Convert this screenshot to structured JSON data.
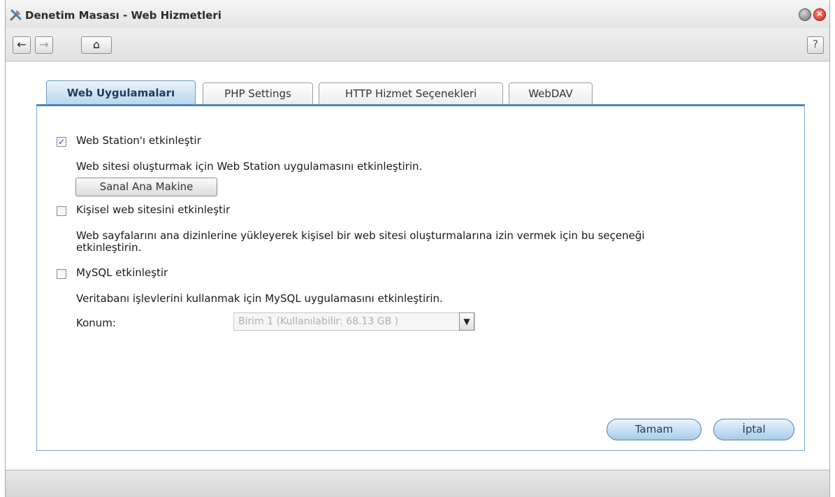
{
  "window": {
    "title": "Denetim Masası - Web Hizmetleri",
    "close_glyph": "✕",
    "icons": {
      "app": "tools-icon",
      "minimize": "minimize-icon",
      "close": "close-icon"
    }
  },
  "toolbar": {
    "back_glyph": "←",
    "forward_glyph": "→",
    "home_glyph": "⌂",
    "help_glyph": "?"
  },
  "tabs": [
    {
      "label": "Web Uygulamaları",
      "active": true
    },
    {
      "label": "PHP Settings",
      "active": false
    },
    {
      "label": "HTTP Hizmet Seçenekleri",
      "active": false
    },
    {
      "label": "WebDAV",
      "active": false
    }
  ],
  "web_station": {
    "checked": true,
    "check_glyph": "✓",
    "label": "Web Station'ı etkinleştir",
    "description": "Web sitesi oluşturmak için Web Station uygulamasını etkinleştirin.",
    "button_label": "Sanal Ana Makine"
  },
  "personal_site": {
    "checked": false,
    "label": "Kişisel web sitesini etkinleştir",
    "description_line1": "Web sayfalarını ana dizinlerine yükleyerek kişisel bir web sitesi oluşturmalarına izin vermek için bu seçeneği",
    "description_line2": "etkinleştirin."
  },
  "mysql": {
    "checked": false,
    "label": "MySQL etkinleştir",
    "description": "Veritabanı işlevlerini kullanmak için MySQL uygulamasını etkinleştirin.",
    "location_label": "Konum:",
    "location_value": "Birim 1 (Kullanılabilir: 68.13 GB )",
    "dropdown_glyph": "▼"
  },
  "actions": {
    "ok_label": "Tamam",
    "cancel_label": "İptal"
  },
  "colors": {
    "accent": "#4c86bd",
    "active_tab": "#b9d5ec",
    "close_button": "#c8231a"
  }
}
